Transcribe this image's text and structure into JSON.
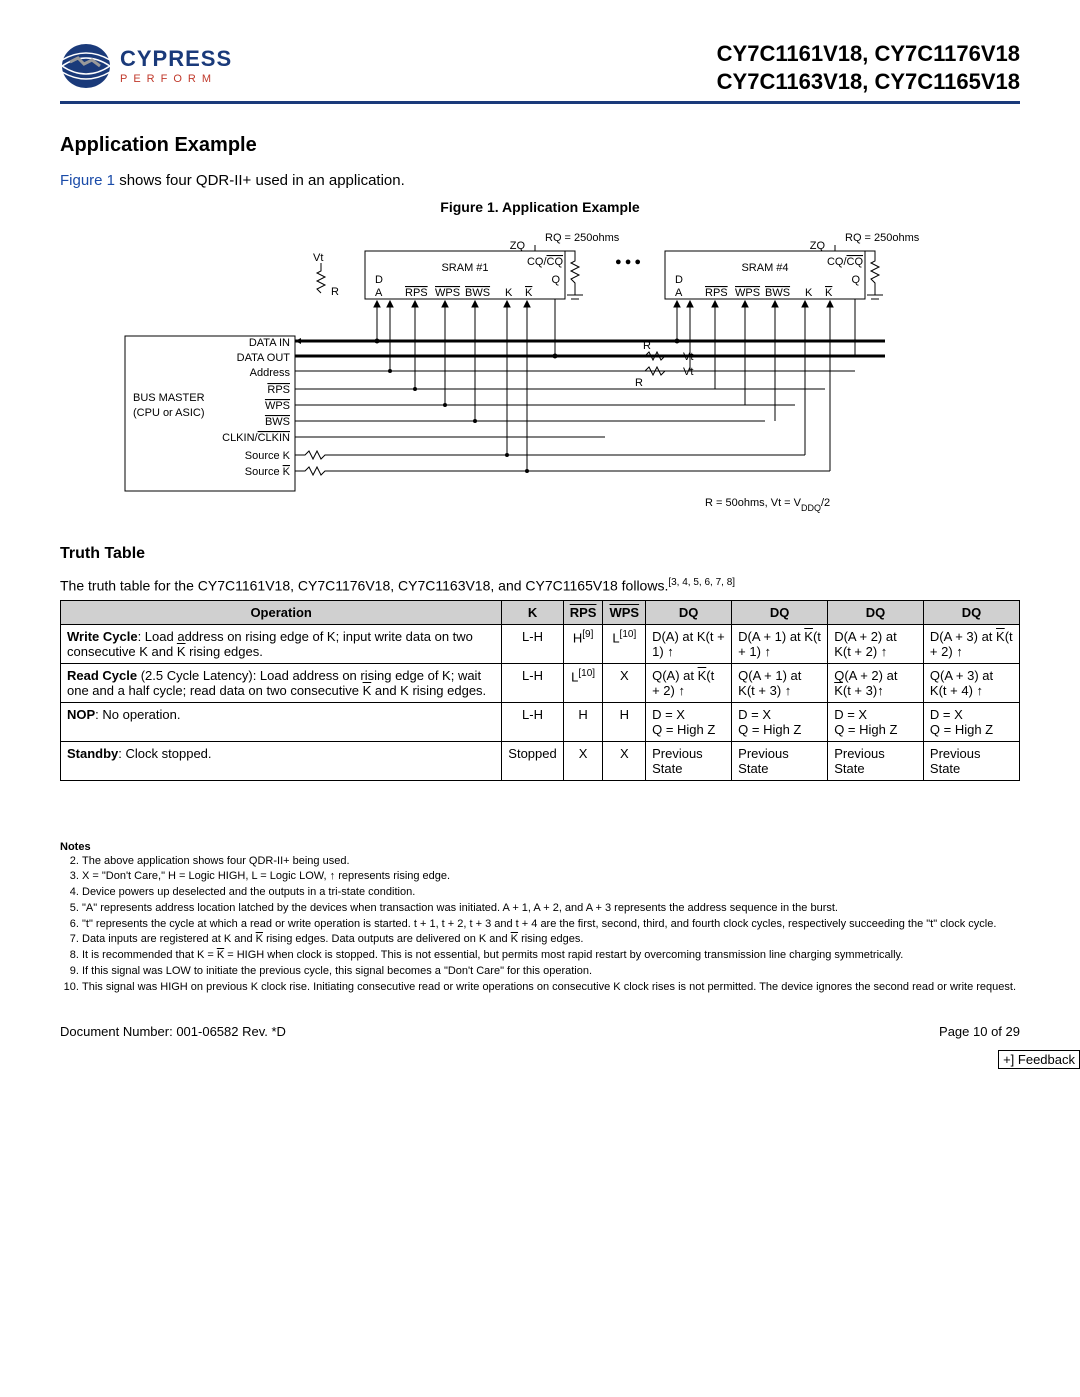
{
  "header": {
    "logo_name": "CYPRESS",
    "logo_tag": "PERFORM",
    "parts_line1": "CY7C1161V18, CY7C1176V18",
    "parts_line2": "CY7C1163V18, CY7C1165V18"
  },
  "section_title": "Application Example",
  "intro_link": "Figure 1",
  "intro_rest": " shows four QDR-II+ used in an application.",
  "figure_caption": "Figure 1. Application Example",
  "diagram": {
    "rq_label1": "RQ = 250ohms",
    "rq_label2": "RQ = 250ohms",
    "vt": "Vt",
    "r": "R",
    "sram1": "SRAM #1",
    "sram4": "SRAM #4",
    "zq": "ZQ",
    "cqcq": "CQ/CQ",
    "d": "D",
    "a": "A",
    "q": "Q",
    "k": "K",
    "kbar": "K",
    "rps": "RPS",
    "wps": "WPS",
    "bws": "BWS",
    "bus_master1": "BUS  MASTER",
    "bus_master2": "(CPU or ASIC)",
    "data_in": "DATA IN",
    "data_out": "DATA OUT",
    "address": "Address",
    "sig_rps": "RPS",
    "sig_wps": "WPS",
    "sig_bws": "BWS",
    "clkin": "CLKIN/CLKIN",
    "src_k": "Source K",
    "src_kbar": "Source K",
    "dots": "● ● ●",
    "rvt1": "Vt",
    "rvt2": "Vt",
    "rlabel": "R",
    "footer_eq": "R = 50ohms, Vt = VDDQ/2"
  },
  "truth_table": {
    "heading": "Truth Table",
    "intro_1": "The truth table for the CY7C1161V18, CY7C1176V18, CY7C1163V18, and CY7C1165V18 follows.",
    "intro_refs": "[3, 4, 5, 6, 7, 8]",
    "headers": [
      "Operation",
      "K",
      "RPS",
      "WPS",
      "DQ",
      "DQ",
      "DQ",
      "DQ"
    ],
    "rows": [
      {
        "op_bold": "Write Cycle",
        "op_rest": ": Load address on rising edge of K; input write data on two consecutive K and K̅ rising edges.",
        "k": "L-H",
        "rps": "H",
        "rps_ref": "[9]",
        "wps": "L",
        "wps_ref": "[10]",
        "dq1": "D(A) at K(t + 1) ↑",
        "dq2": "D(A + 1) at K̅(t + 1) ↑",
        "dq3": "D(A + 2) at K(t + 2) ↑",
        "dq4": "D(A + 3) at K̅(t + 2) ↑"
      },
      {
        "op_bold": "Read Cycle",
        "op_rest": " (2.5 Cycle Latency): Load address on rising edge of K; wait one and a half cycle; read data on two consecutive K̅ and K rising edges.",
        "k": "L-H",
        "rps": "L",
        "rps_ref": "[10]",
        "wps": "X",
        "wps_ref": "",
        "dq1": "Q(A) at K̅(t + 2) ↑",
        "dq2": "Q(A + 1) at K(t + 3) ↑",
        "dq3": "Q(A + 2) at K̅(t + 3)↑",
        "dq4": "Q(A + 3) at K(t + 4) ↑"
      },
      {
        "op_bold": "NOP",
        "op_rest": ": No operation.",
        "k": "L-H",
        "rps": "H",
        "rps_ref": "",
        "wps": "H",
        "wps_ref": "",
        "dq1": "D = X\nQ = High Z",
        "dq2": "D = X\nQ = High Z",
        "dq3": "D = X\nQ = High Z",
        "dq4": "D = X\nQ = High Z"
      },
      {
        "op_bold": "Standby",
        "op_rest": ": Clock stopped.",
        "k": "Stopped",
        "rps": "X",
        "rps_ref": "",
        "wps": "X",
        "wps_ref": "",
        "dq1": "Previous State",
        "dq2": "Previous State",
        "dq3": "Previous State",
        "dq4": "Previous State"
      }
    ]
  },
  "notes": {
    "heading": "Notes",
    "items": [
      "The above application shows four QDR-II+ being used.",
      "X = \"Don't Care,\" H = Logic HIGH, L = Logic LOW, ↑ represents rising edge.",
      "Device powers up deselected and the outputs in a tri-state condition.",
      "\"A\" represents address location latched by the devices when transaction was initiated. A + 1, A + 2, and A + 3 represents the address sequence in the burst.",
      "\"t\" represents the cycle at which a read or write operation is started. t + 1, t + 2, t + 3 and t + 4 are the first, second, third, and fourth clock cycles, respectively succeeding the \"t\" clock cycle.",
      "Data inputs are registered at K and K̅ rising edges. Data outputs are delivered on K and K̅ rising edges.",
      "It is recommended that K = K̅ = HIGH when clock is stopped. This is not essential, but permits most rapid restart by overcoming transmission line charging symmetrically.",
      "If this signal was LOW to initiate the previous cycle, this signal becomes a \"Don't Care\" for this operation.",
      "This signal was HIGH on previous K clock rise. Initiating consecutive read or write operations on consecutive K clock rises is not permitted. The device ignores the second read or write request."
    ]
  },
  "footer": {
    "doc": "Document Number: 001-06582 Rev. *D",
    "page": "Page 10 of 29",
    "feedback": "+] Feedback"
  }
}
